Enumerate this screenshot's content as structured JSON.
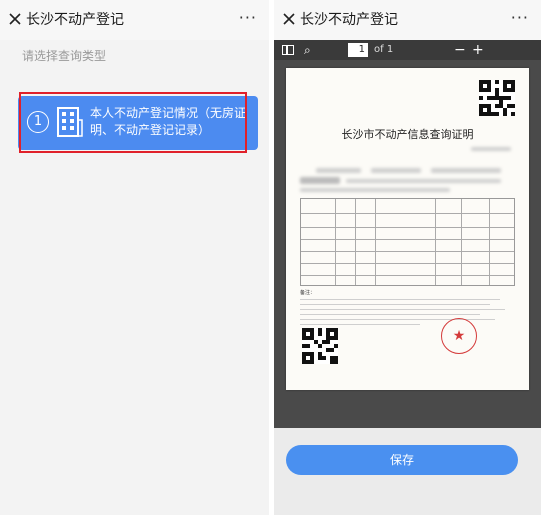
{
  "left_screen": {
    "title": "长沙不动产登记",
    "more_label": "···",
    "prompt": "请选择查询类型",
    "option": {
      "number": "1",
      "icon": "building-icon",
      "label": "本人不动产登记情况（无房证明、不动产登记记录）"
    }
  },
  "right_screen": {
    "title": "长沙不动产登记",
    "more_label": "···",
    "toolbar": {
      "search_icon": "⌕",
      "page_current": "1",
      "page_total": "of 1",
      "zoom_out": "−",
      "zoom_in": "+"
    },
    "document": {
      "title": "长沙市不动产信息查询证明",
      "notes_label": "备注："
    },
    "save_label": "保存"
  },
  "colors": {
    "accent": "#4a90f0",
    "highlight": "#e0202a",
    "seal": "#d43a3a"
  }
}
